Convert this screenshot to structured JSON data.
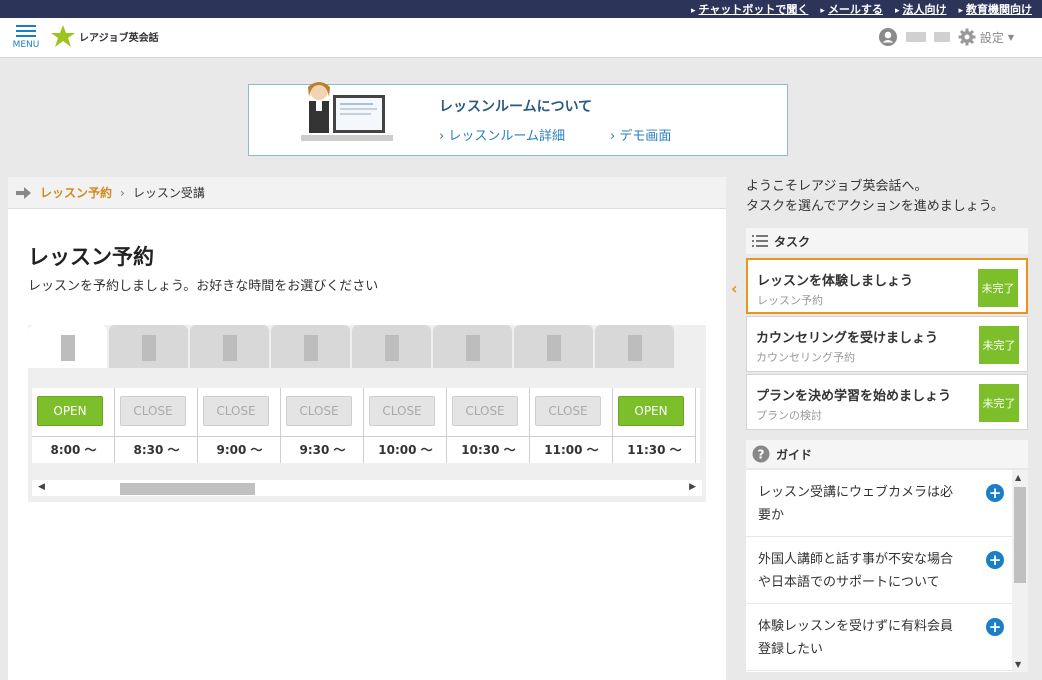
{
  "top_links": [
    "チャットボットで聞く",
    "メールする",
    "法人向け",
    "教育機関向け"
  ],
  "header": {
    "menu_label": "MENU",
    "logo_text": "レアジョブ英会話",
    "settings_label": "設定"
  },
  "banner": {
    "title": "レッスンルームについて",
    "link_detail": "レッスンルーム詳細",
    "link_demo": "デモ画面"
  },
  "breadcrumb": {
    "current": "レッスン予約",
    "next": "レッスン受講"
  },
  "main": {
    "title": "レッスン予約",
    "subtitle": "レッスンを予約しましょう。お好きな時間をお選びください"
  },
  "slots": [
    {
      "status": "OPEN",
      "time": "8:00 〜"
    },
    {
      "status": "CLOSE",
      "time": "8:30 〜"
    },
    {
      "status": "CLOSE",
      "time": "9:00 〜"
    },
    {
      "status": "CLOSE",
      "time": "9:30 〜"
    },
    {
      "status": "CLOSE",
      "time": "10:00 〜"
    },
    {
      "status": "CLOSE",
      "time": "10:30 〜"
    },
    {
      "status": "CLOSE",
      "time": "11:00 〜"
    },
    {
      "status": "OPEN",
      "time": "11:30 〜"
    }
  ],
  "welcome": {
    "line1": "ようこそレアジョブ英会話へ。",
    "line2": "タスクを選んでアクションを進めましょう。"
  },
  "tasks": {
    "header": "タスク",
    "items": [
      {
        "title": "レッスンを体験しましょう",
        "sub": "レッスン予約",
        "badge": "未完了"
      },
      {
        "title": "カウンセリングを受けましょう",
        "sub": "カウンセリング予約",
        "badge": "未完了"
      },
      {
        "title": "プランを決め学習を始めましょう",
        "sub": "プランの検討",
        "badge": "未完了"
      }
    ]
  },
  "guide": {
    "header": "ガイド",
    "items": [
      {
        "line1": "レッスン受講にウェブカメラは必",
        "line2": "要か"
      },
      {
        "line1": "外国人講師と話す事が不安な場合",
        "line2": "や日本語でのサポートについて"
      },
      {
        "line1": "体験レッスンを受けずに有料会員",
        "line2": "登録したい"
      }
    ]
  },
  "colors": {
    "topbar": "#2c3559",
    "accent_blue": "#1a7fc4",
    "open_green": "#7cbf2a",
    "active_orange": "#e8941e"
  }
}
